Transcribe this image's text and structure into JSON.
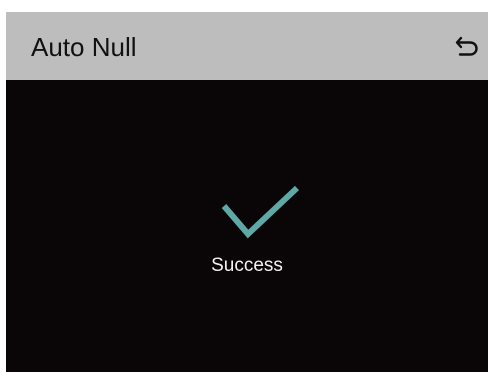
{
  "header": {
    "title": "Auto Null",
    "back_icon": "undo-arrow-icon"
  },
  "result": {
    "icon": "checkmark-icon",
    "icon_color": "#5ea8a6",
    "status": "Success"
  },
  "colors": {
    "header_background": "#bdbdbd",
    "screen_background": "#0a0506",
    "title_text": "#111111",
    "status_text": "#f2f2f2"
  }
}
